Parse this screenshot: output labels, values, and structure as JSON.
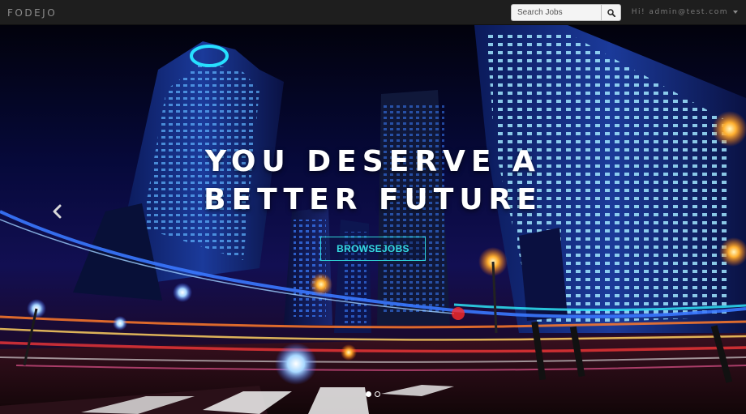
{
  "navbar": {
    "brand": "FODEJO",
    "search": {
      "placeholder": "Search Jobs",
      "value": ""
    },
    "user_menu": {
      "label": "Hi! admin@test.com"
    }
  },
  "hero": {
    "headline_line1": "YOU DESERVE A",
    "headline_line2": "BETTER FUTURE",
    "browse_button": "BROWSEJOBS",
    "indicators": {
      "count": 2,
      "active": 0
    }
  },
  "colors": {
    "navbar_bg": "#1e1e1e",
    "accent_cyan": "#35dbe2",
    "headline": "#ffffff"
  },
  "icons": {
    "search": "search-icon",
    "caret": "caret-down-icon",
    "prev": "chevron-left-icon"
  }
}
